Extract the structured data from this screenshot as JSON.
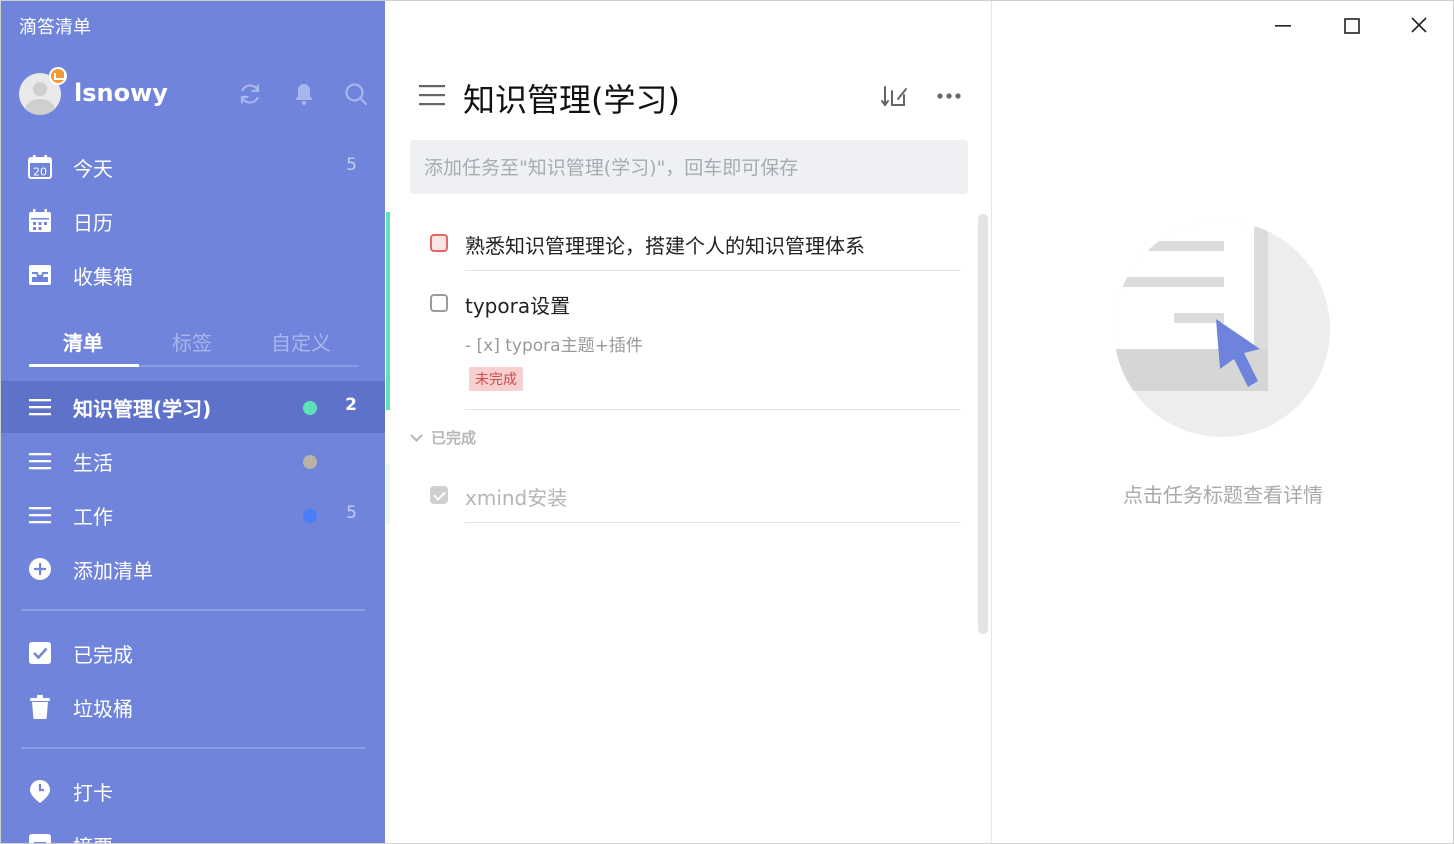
{
  "app": {
    "title": "滴答清单"
  },
  "user": {
    "name": "lsnowy"
  },
  "colors": {
    "sidebar": "#7084db",
    "sidebar_active": "#5e72c9",
    "accent_green": "#5fe3b6",
    "accent_blue": "#4a7df6"
  },
  "sidebar": {
    "icons": [
      "sync-icon",
      "bell-icon",
      "search-icon"
    ],
    "smart_lists": [
      {
        "label": "今天",
        "count": "5",
        "icon": "calendar-day-icon",
        "day": "20"
      },
      {
        "label": "日历",
        "icon": "calendar-icon"
      },
      {
        "label": "收集箱",
        "icon": "inbox-icon"
      }
    ],
    "tabs": [
      {
        "label": "清单",
        "active": true
      },
      {
        "label": "标签"
      },
      {
        "label": "自定义"
      }
    ],
    "lists": [
      {
        "label": "知识管理(学习)",
        "count": "2",
        "dot": "#5fe3b6",
        "active": true
      },
      {
        "label": "生活",
        "dot": "#b9b3a4"
      },
      {
        "label": "工作",
        "count": "5",
        "dot": "#4a7df6"
      }
    ],
    "add_list": "添加清单",
    "bottom": [
      {
        "label": "已完成",
        "icon": "checkbox-icon"
      },
      {
        "label": "垃圾桶",
        "icon": "trash-icon"
      },
      {
        "label": "打卡",
        "icon": "clock-pin-icon"
      },
      {
        "label": "摘要",
        "icon": "summary-icon"
      }
    ]
  },
  "main": {
    "title": "知识管理(学习)",
    "add_placeholder": "添加任务至\"知识管理(学习)\"，回车即可保存",
    "tasks": [
      {
        "title": "熟悉知识管理理论，搭建个人的知识管理体系",
        "priority": "high",
        "done": false
      },
      {
        "title": "typora设置",
        "note": "- [x] typora主题+插件",
        "tag": "未完成",
        "done": false
      }
    ],
    "completed_label": "已完成",
    "completed_tasks": [
      {
        "title": "xmind安装",
        "done": true
      }
    ]
  },
  "detail": {
    "empty_text": "点击任务标题查看详情"
  }
}
